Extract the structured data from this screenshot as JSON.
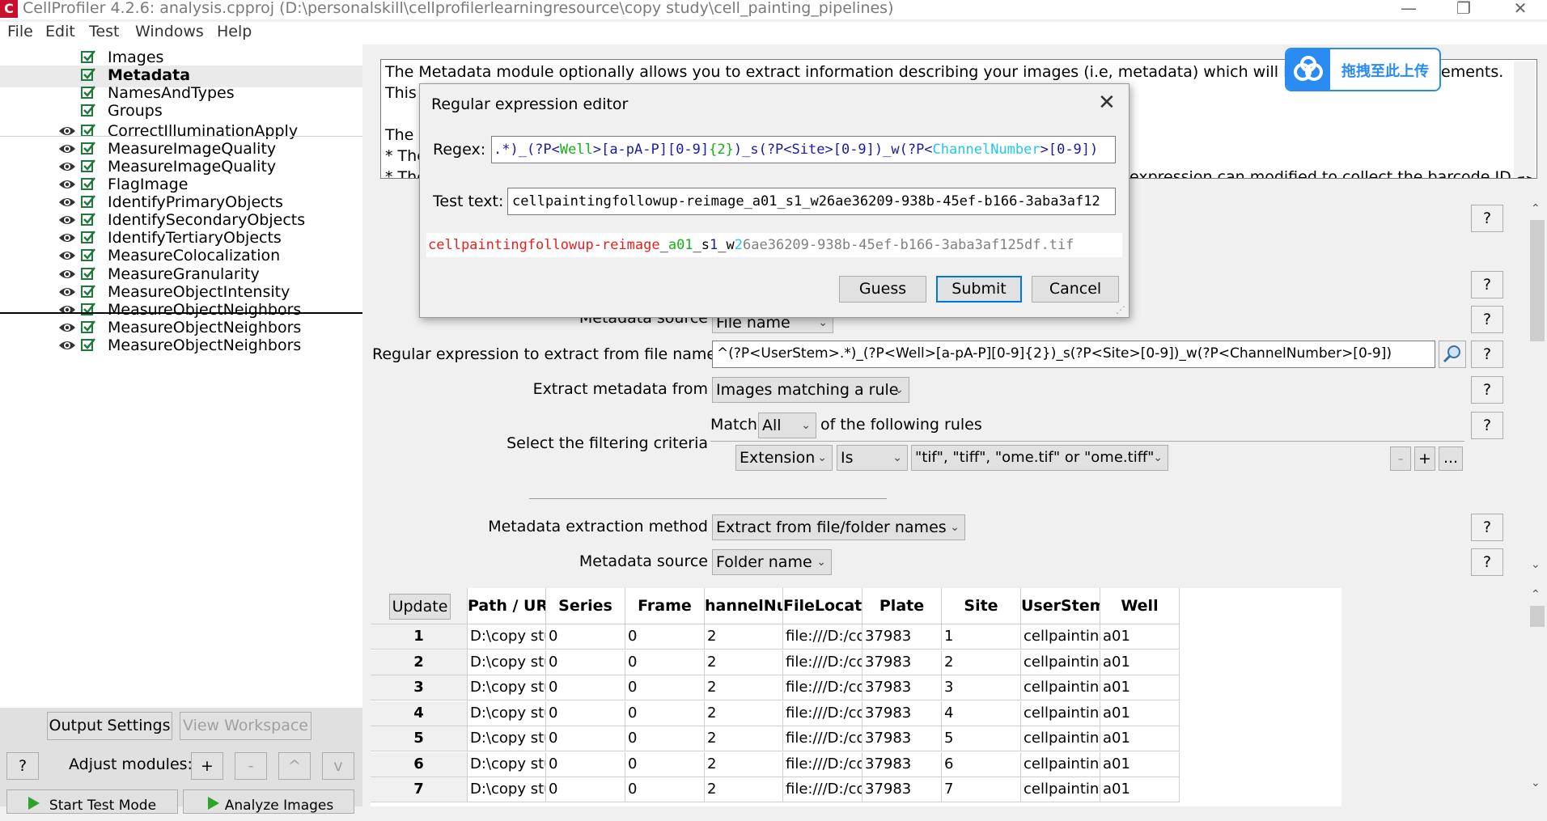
{
  "window": {
    "title": "CellProfiler 4.2.6: analysis.cpproj (D:\\personalskill\\cellprofilerlearningresource\\copy study\\cell_painting_pipelines)",
    "min_glyph": "—",
    "max_glyph": "❐",
    "close_glyph": "✕"
  },
  "menu": [
    "File",
    "Edit",
    "Test",
    "Windows",
    "Help"
  ],
  "modules": [
    {
      "name": "Images",
      "eye": false,
      "selected": false
    },
    {
      "name": "Metadata",
      "eye": false,
      "selected": true
    },
    {
      "name": "NamesAndTypes",
      "eye": false,
      "selected": false
    },
    {
      "name": "Groups",
      "eye": false,
      "selected": false
    },
    {
      "name": "CorrectIlluminationApply",
      "eye": true,
      "selected": false
    },
    {
      "name": "MeasureImageQuality",
      "eye": true,
      "selected": false
    },
    {
      "name": "MeasureImageQuality",
      "eye": true,
      "selected": false
    },
    {
      "name": "FlagImage",
      "eye": true,
      "selected": false
    },
    {
      "name": "IdentifyPrimaryObjects",
      "eye": true,
      "selected": false
    },
    {
      "name": "IdentifySecondaryObjects",
      "eye": true,
      "selected": false
    },
    {
      "name": "IdentifyTertiaryObjects",
      "eye": true,
      "selected": false
    },
    {
      "name": "MeasureColocalization",
      "eye": true,
      "selected": false
    },
    {
      "name": "MeasureGranularity",
      "eye": true,
      "selected": false
    },
    {
      "name": "MeasureObjectIntensity",
      "eye": true,
      "selected": false
    },
    {
      "name": "MeasureObjectNeighbors",
      "eye": true,
      "selected": false
    },
    {
      "name": "MeasureObjectNeighbors",
      "eye": true,
      "selected": false
    },
    {
      "name": "MeasureObjectNeighbors",
      "eye": true,
      "selected": false
    }
  ],
  "sidebar_bottom": {
    "output_settings": "Output Settings",
    "view_workspace": "View Workspace",
    "help": "?",
    "adjust_label": "Adjust modules:",
    "add": "+",
    "remove": "-",
    "up": "^",
    "down": "v",
    "start_test": "Start Test Mode",
    "analyze": "Analyze Images"
  },
  "help_text": {
    "line1": "The Metadata module optionally allows you to extract information describing your images (i.e, metadata) which will be stored a",
    "line1_tail": "ements.",
    "line2": "This i",
    "line3": "The s",
    "line4": "* The",
    "line5": "* The",
    "line5_tail": "expression can modified to collect the barcode ID as"
  },
  "upload": {
    "label": "拖拽至此上传"
  },
  "settings": {
    "metadata_source_label": "Metadata source",
    "metadata_source_value": "File name",
    "regex_label": "Regular expression to extract from file name",
    "regex_value": "^(?P<UserStem>.*)_(?P<Well>[a-pA-P][0-9]{2})_s(?P<Site>[0-9])_w(?P<ChannelNumber>[0-9])",
    "extract_from_label": "Extract metadata from",
    "extract_from_value": "Images matching a rule",
    "match_label": "Match",
    "match_value": "All",
    "following_rules": "of the following rules",
    "filter_label": "Select the filtering criteria",
    "rule_field": "Extension",
    "rule_op": "Is",
    "rule_value": "\"tif\", \"tiff\", \"ome.tif\" or \"ome.tiff\"",
    "rule_minus": "-",
    "rule_plus": "+",
    "rule_more": "...",
    "method_label": "Metadata extraction method",
    "method_value": "Extract from file/folder names",
    "source2_label": "Metadata source",
    "source2_value": "Folder name",
    "help_q": "?"
  },
  "dialog": {
    "title": "Regular expression editor",
    "regex_label": "Regex:",
    "test_label": "Test text:",
    "test_value": "cellpaintingfollowup-reimage_a01_s1_w26ae36209-938b-45ef-b166-3aba3af12",
    "guess": "Guess",
    "submit": "Submit",
    "cancel": "Cancel",
    "regex_parts": [
      {
        "t": ".*)_(?P<",
        "c": "#1a1aa6"
      },
      {
        "t": "Well",
        "c": "#18b018"
      },
      {
        "t": ">[a-pA-P][0-9]",
        "c": "#1a1aa6"
      },
      {
        "t": "{2}",
        "c": "#18b018"
      },
      {
        "t": ")_s(",
        "c": "#1a1aa6"
      },
      {
        "t": "?P<",
        "c": "#1a1aa6"
      },
      {
        "t": "Site",
        "c": "#1a1aa6"
      },
      {
        "t": ">[0-9])_w(?P<",
        "c": "#1a1aa6"
      },
      {
        "t": "ChannelNumber",
        "c": "#22c8e8"
      },
      {
        "t": ">[0-9])",
        "c": "#1a1aa6"
      }
    ],
    "match_parts": [
      {
        "t": "cellpaintingfollowup-reimage",
        "c": "#e8201c"
      },
      {
        "t": "_",
        "c": "#000000"
      },
      {
        "t": "a01",
        "c": "#18b018"
      },
      {
        "t": "_s",
        "c": "#000000"
      },
      {
        "t": "1",
        "c": "#1a1aa6"
      },
      {
        "t": "_w",
        "c": "#000000"
      },
      {
        "t": "2",
        "c": "#22c8e8"
      },
      {
        "t": "6ae36209-938b-45ef-b166-3aba3af125df.tif",
        "c": "#808080"
      }
    ]
  },
  "table": {
    "update": "Update",
    "headers": [
      "Path / URL",
      "Series",
      "Frame",
      "hannelNumb",
      "FileLocation",
      "Plate",
      "Site",
      "UserStem",
      "Well"
    ],
    "rows": [
      [
        "1",
        "D:\\copy study",
        "0",
        "0",
        "2",
        "file:///D:/co...",
        "37983",
        "1",
        "cellpaintingfc",
        "a01"
      ],
      [
        "2",
        "D:\\copy study",
        "0",
        "0",
        "2",
        "file:///D:/co...",
        "37983",
        "2",
        "cellpaintingfc",
        "a01"
      ],
      [
        "3",
        "D:\\copy study",
        "0",
        "0",
        "2",
        "file:///D:/co...",
        "37983",
        "3",
        "cellpaintingfc",
        "a01"
      ],
      [
        "4",
        "D:\\copy study",
        "0",
        "0",
        "2",
        "file:///D:/co...",
        "37983",
        "4",
        "cellpaintingfc",
        "a01"
      ],
      [
        "5",
        "D:\\copy study",
        "0",
        "0",
        "2",
        "file:///D:/co...",
        "37983",
        "5",
        "cellpaintingfc",
        "a01"
      ],
      [
        "6",
        "D:\\copy study",
        "0",
        "0",
        "2",
        "file:///D:/co...",
        "37983",
        "6",
        "cellpaintingfc",
        "a01"
      ],
      [
        "7",
        "D:\\copy study",
        "0",
        "0",
        "2",
        "file:///D:/co...",
        "37983",
        "7",
        "cellpaintingfc",
        "a01"
      ]
    ]
  },
  "colors": {
    "accent": "#2a8cf0",
    "check": "#1e7a3c",
    "selected_row": "#eaeaea"
  }
}
